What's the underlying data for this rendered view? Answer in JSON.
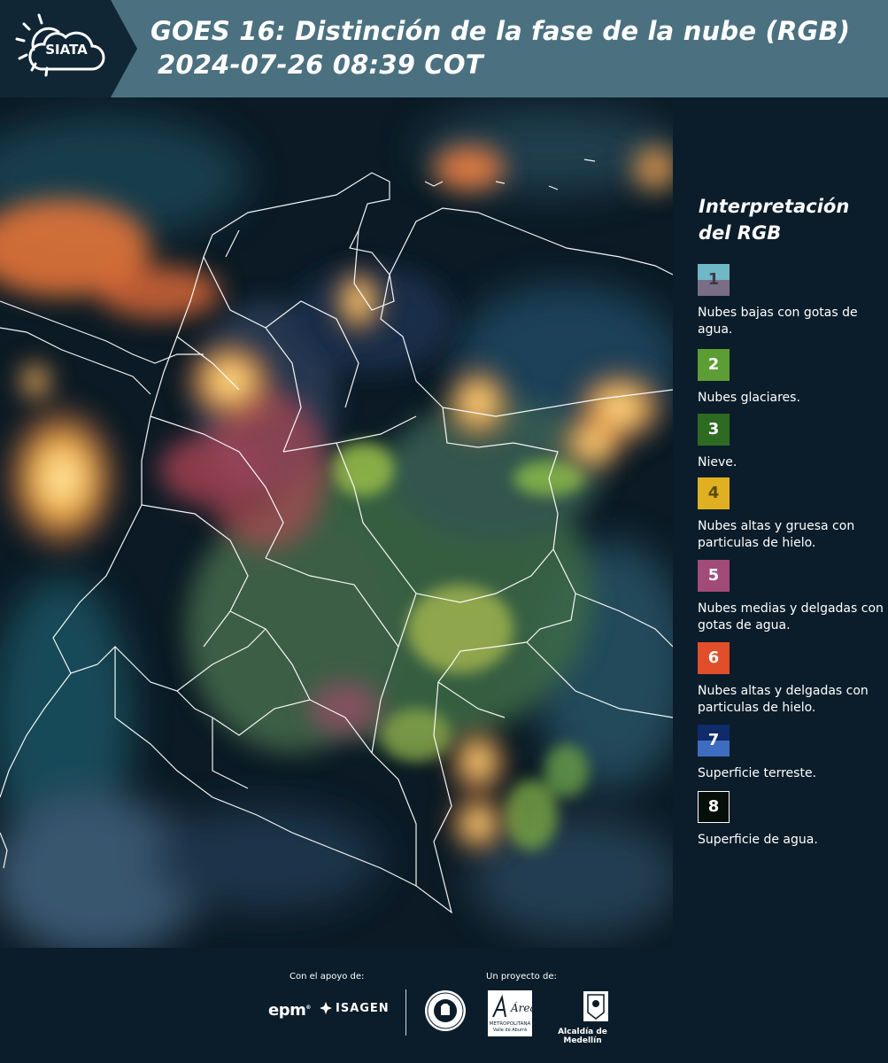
{
  "header": {
    "logo_text": "SIATA",
    "title_line1": "GOES 16: Distinción de la fase de la nube (RGB)",
    "title_line2": "2024-07-26 08:39 COT"
  },
  "legend": {
    "title_line1": "Interpretación",
    "title_line2": "del RGB",
    "items": [
      {
        "number": "1",
        "label": "Nubes bajas con gotas de agua.",
        "color_top": "#6fb8c6",
        "color_bottom": "#7a6e86",
        "text_color": "#3a3a48"
      },
      {
        "number": "2",
        "label": "Nubes glaciares.",
        "color": "#5c9e33",
        "text_color": "#ffffff"
      },
      {
        "number": "3",
        "label": "Nieve.",
        "color": "#2e6a22",
        "text_color": "#ffffff"
      },
      {
        "number": "4",
        "label": "Nubes altas y gruesa con particulas de hielo.",
        "color": "#e0b022",
        "text_color": "#5a4a10"
      },
      {
        "number": "5",
        "label": "Nubes medias y delgadas con gotas de agua.",
        "color": "#a24a78",
        "text_color": "#ffffff"
      },
      {
        "number": "6",
        "label": "Nubes altas y delgadas con particulas de hielo.",
        "color": "#e14e2a",
        "text_color": "#ffffff"
      },
      {
        "number": "7",
        "label": "Superficie terreste.",
        "color_top": "#0f2b6a",
        "color_bottom": "#3e6cc0",
        "text_color": "#ffffff"
      },
      {
        "number": "8",
        "label": "Superficie de agua.",
        "color": "#050e08",
        "text_color": "#ffffff",
        "border": "#ffffff"
      }
    ]
  },
  "footer": {
    "support_label": "Con el apoyo de:",
    "project_label": "Un proyecto de:",
    "sponsor_epm": "epm",
    "sponsor_isagen": "ISAGEN",
    "amva_text": "Área",
    "amva_subtitle": "METROPOLITANA",
    "amva_subtitle2": "Valle de Aburrá",
    "medellin_label": "Alcaldía de Medellín"
  }
}
